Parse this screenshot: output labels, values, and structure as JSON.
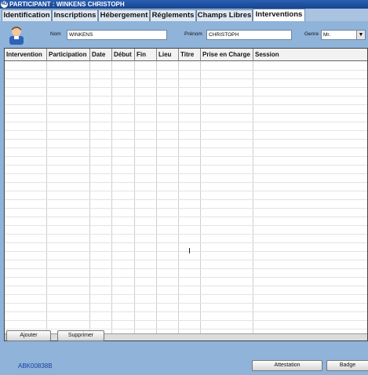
{
  "window": {
    "title": "PARTICIPANT : WINKENS CHRISTOPH",
    "app_icon": "4D"
  },
  "tabs": [
    {
      "label": "Identification",
      "active": false
    },
    {
      "label": "Inscriptions",
      "active": false
    },
    {
      "label": "Hébergement",
      "active": false
    },
    {
      "label": "Réglements",
      "active": false
    },
    {
      "label": "Champs Libres",
      "active": false
    },
    {
      "label": "Interventions",
      "active": true
    }
  ],
  "header": {
    "avatar_icon": "person-avatar-icon",
    "nom_label": "Nom",
    "nom_value": "WINKENS",
    "prenom_label": "Prénom",
    "prenom_value": "CHRISTOPH",
    "genre_label": "Genre",
    "genre_value": "Mr."
  },
  "table": {
    "columns": [
      "Intervention",
      "Participation",
      "Date",
      "Début",
      "Fin",
      "Lieu",
      "Titre",
      "Prise en Charge",
      "Session"
    ],
    "rows": []
  },
  "buttons": {
    "ajouter": "Ajouter",
    "supprimer": "Supprimer",
    "attestation": "Attestation",
    "badge": "Badge"
  },
  "footer": {
    "code": "ABK00838B"
  },
  "colors": {
    "background": "#8fb3d9",
    "titlebar": "#17448f",
    "code_text": "#1a3fa0"
  }
}
